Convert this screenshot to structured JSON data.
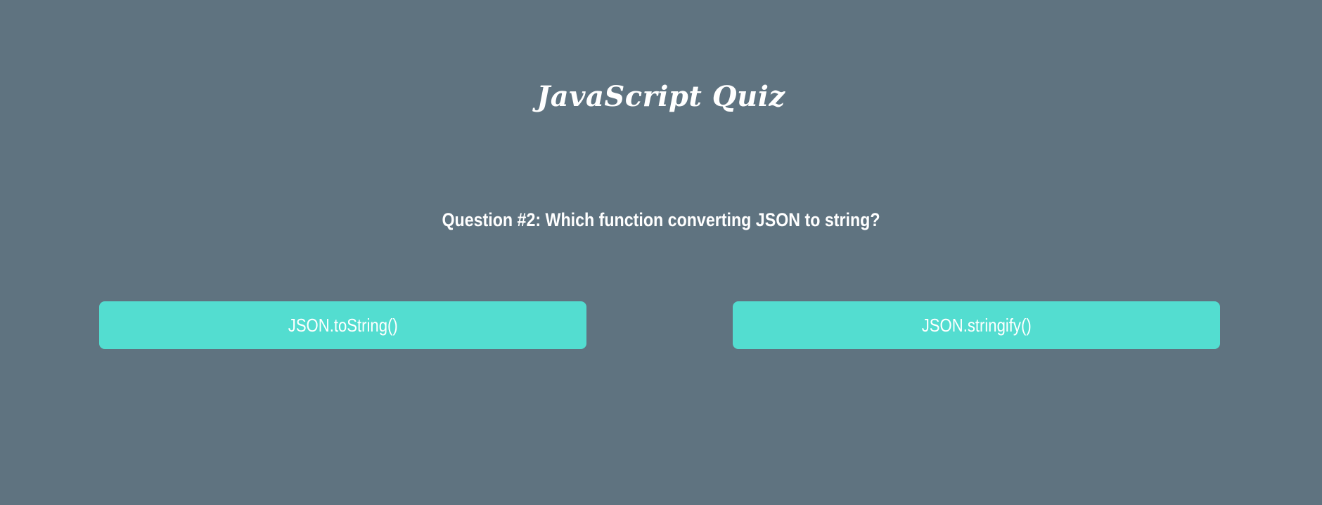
{
  "quiz": {
    "title": "JavaScript Quiz",
    "question": "Question #2: Which function converting JSON to string?",
    "answers": [
      {
        "label": "JSON.toString()"
      },
      {
        "label": "JSON.stringify()"
      }
    ]
  },
  "colors": {
    "background": "#5f7380",
    "button": "#53ddd0",
    "text": "#ffffff"
  }
}
